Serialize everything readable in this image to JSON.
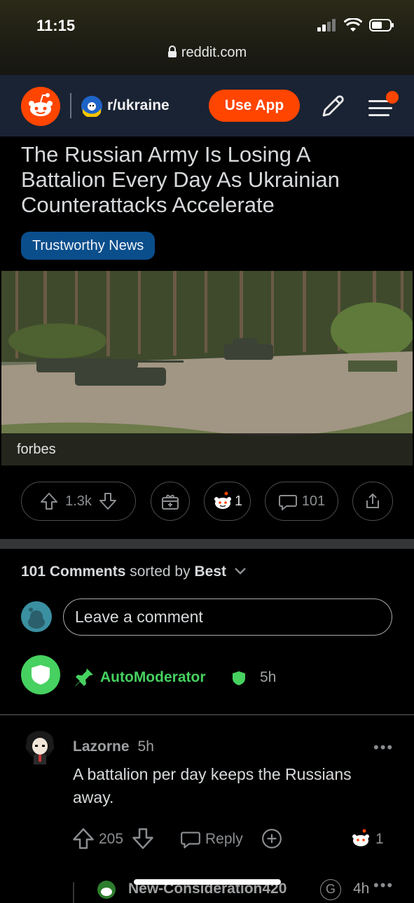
{
  "status": {
    "time": "11:15",
    "url": "reddit.com"
  },
  "nav": {
    "subreddit": "r/ukraine",
    "use_app_label": "Use App"
  },
  "post": {
    "title": "The Russian Army Is Losing A Battalion Every Day As Ukrainian Counterattacks Accelerate",
    "flair": "Trustworthy News",
    "image_caption": "forbes",
    "votes": "1.3k",
    "awards": "1",
    "comments_count": "101"
  },
  "comments": {
    "count_label": "101 Comments",
    "sorted_by_label": "sorted by",
    "sort_value": "Best",
    "placeholder": "Leave a comment",
    "automod": {
      "name": "AutoModerator",
      "time": "5h"
    },
    "items": [
      {
        "author": "Lazorne",
        "time": "5h",
        "body": "A battalion per day keeps the Russians away.",
        "votes": "205",
        "reply_label": "Reply",
        "awards": "1"
      }
    ],
    "reply_preview": {
      "author": "New-Consideration420",
      "badge": "G",
      "time": "4h"
    }
  },
  "colors": {
    "accent": "#ff4500",
    "mod_green": "#46d160",
    "flair_blue": "#0a4e8c",
    "nav_bg": "#1a2333"
  }
}
